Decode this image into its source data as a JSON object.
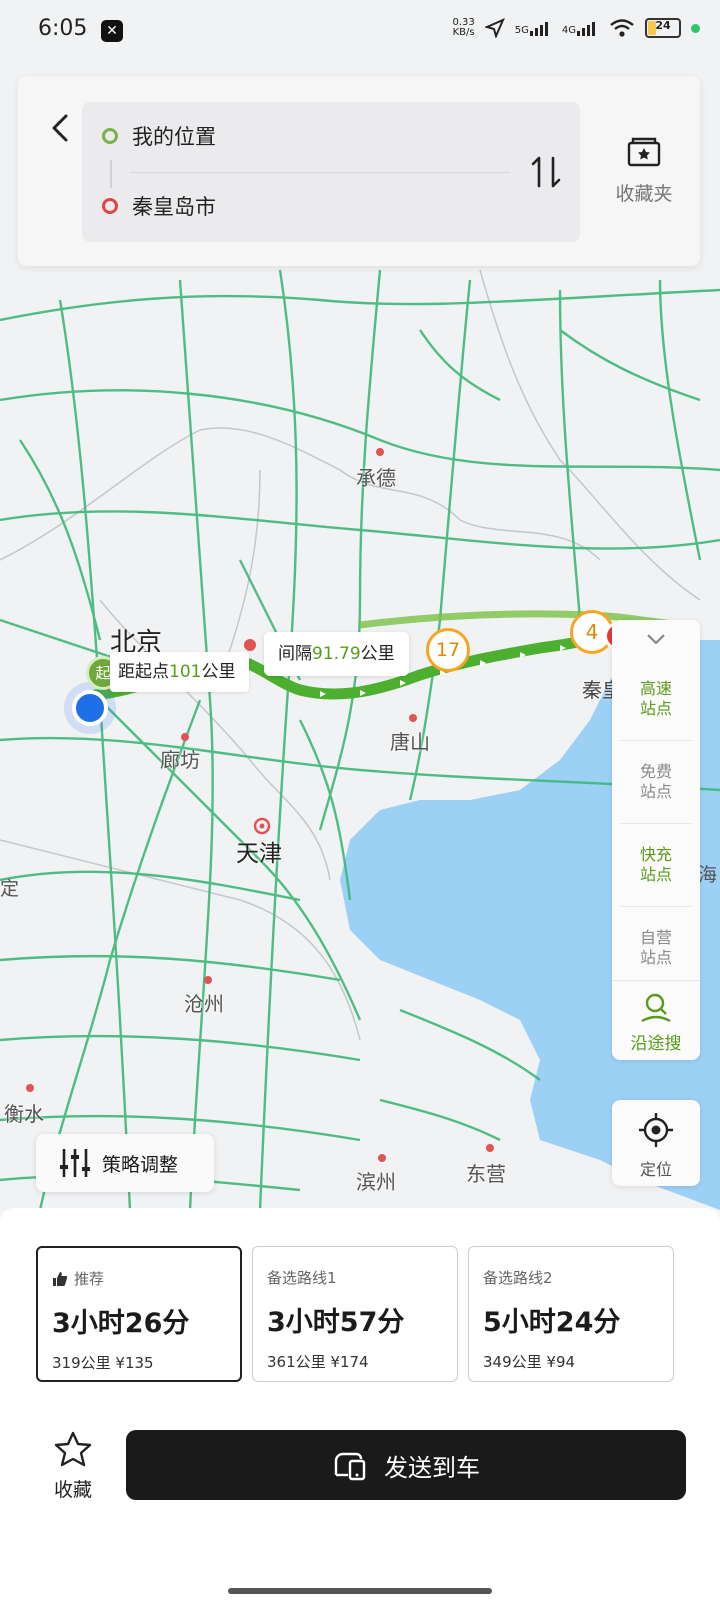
{
  "status_bar": {
    "time": "6:05",
    "net_speed_top": "0.33",
    "net_speed_bottom": "KB/s",
    "sig1": "5G",
    "sig2": "4G",
    "battery": "24"
  },
  "route": {
    "origin": "我的位置",
    "destination": "秦皇岛市",
    "favorites_folder": "收藏夹"
  },
  "map": {
    "cities": {
      "chengde": "承德",
      "beijing": "北京",
      "langfang": "廊坊",
      "tianjin": "天津",
      "tangshan": "唐山",
      "cangzhou": "沧州",
      "hengshui": "衡水",
      "binzhou": "滨州",
      "dongying": "东营",
      "qinhuang": "秦皇",
      "hai": "海",
      "ding": "定"
    },
    "start_marker": "起",
    "start_distance": {
      "prefix": "距起点",
      "value": "101",
      "unit": "公里"
    },
    "interval": {
      "prefix": "间隔",
      "value": "91.79",
      "unit": "公里"
    },
    "markers": [
      "17",
      "4"
    ],
    "colors": {
      "road": "#3cb878",
      "route": "#4caf2f",
      "water": "#9cd0f5",
      "accent_green": "#5a9a1a"
    }
  },
  "side_panel": {
    "items": [
      {
        "label_l1": "高速",
        "label_l2": "站点",
        "active": true
      },
      {
        "label_l1": "免费",
        "label_l2": "站点",
        "active": false
      },
      {
        "label_l1": "快充",
        "label_l2": "站点",
        "active": true
      },
      {
        "label_l1": "自营",
        "label_l2": "站点",
        "active": false
      }
    ],
    "search_along": "沿途搜",
    "locate": "定位"
  },
  "strategy": "策略调整",
  "routes": [
    {
      "label": "推荐",
      "time": "3小时26分",
      "distance": "319公里",
      "cost": "¥135",
      "icon": "thumbs-up-icon"
    },
    {
      "label": "备选路线1",
      "time": "3小时57分",
      "distance": "361公里",
      "cost": "¥174"
    },
    {
      "label": "备选路线2",
      "time": "5小时24分",
      "distance": "349公里",
      "cost": "¥94"
    }
  ],
  "actions": {
    "collect": "收藏",
    "send": "发送到车"
  }
}
